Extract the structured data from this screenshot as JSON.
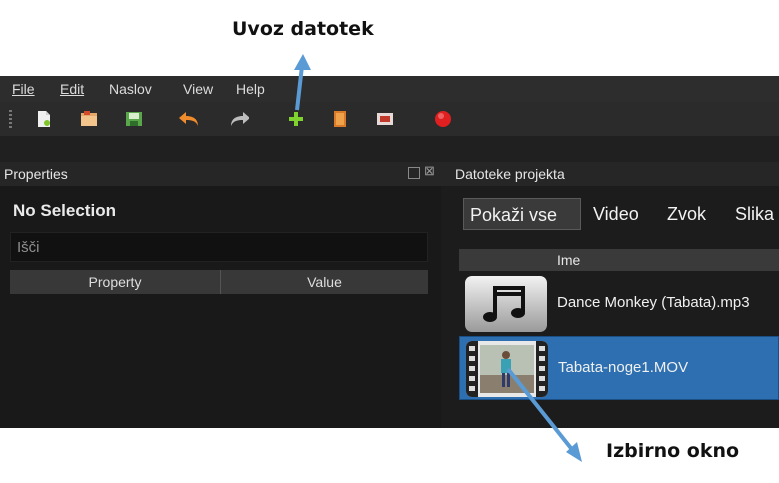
{
  "annotations": {
    "top_label": "Uvoz datotek",
    "bottom_label": "Izbirno okno"
  },
  "menu": {
    "items": [
      "File",
      "Edit",
      "Naslov",
      "View",
      "Help"
    ]
  },
  "toolbar": {
    "buttons": [
      "new-project",
      "open-project",
      "save-project",
      "undo",
      "redo",
      "import-files",
      "profile",
      "fullscreen",
      "export-video"
    ],
    "accent_colors": {
      "undo": "#f08c2c",
      "redo": "#bfbfbf",
      "import": "#7fd12e",
      "record": "#e02020"
    }
  },
  "properties": {
    "title": "Properties",
    "selection": "No Selection",
    "search_placeholder": "Išči",
    "columns": [
      "Property",
      "Value"
    ]
  },
  "project_files": {
    "title": "Datoteke projekta",
    "tabs": [
      "Pokaži vse",
      "Video",
      "Zvok",
      "Slika"
    ],
    "active_tab": "Pokaži vse",
    "column_header": "Ime",
    "files": [
      {
        "name": "Dance Monkey (Tabata).mp3",
        "type": "audio",
        "selected": false
      },
      {
        "name": "Tabata-noge1.MOV",
        "type": "video",
        "selected": true
      }
    ]
  },
  "colors": {
    "selection": "#2d6fb0",
    "arrow": "#5b9bd5"
  }
}
